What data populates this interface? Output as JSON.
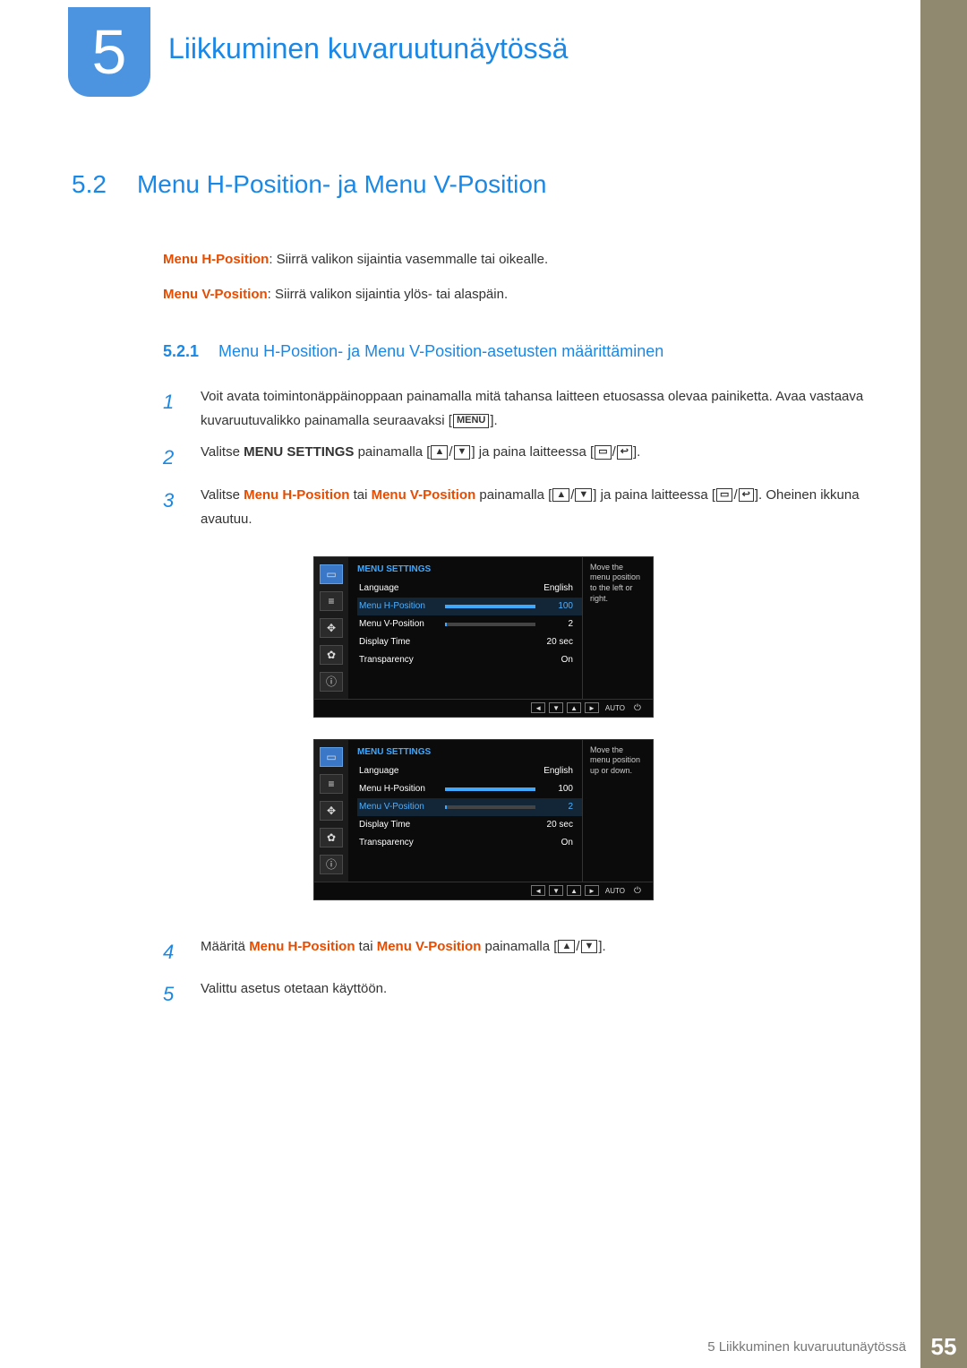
{
  "chapter": {
    "num": "5",
    "title": "Liikkuminen kuvaruutunäytössä"
  },
  "section": {
    "num": "5.2",
    "title": "Menu H-Position- ja Menu V-Position"
  },
  "intro": {
    "line1_term": "Menu H-Position",
    "line1_rest": ": Siirrä valikon sijaintia vasemmalle tai oikealle.",
    "line2_term": "Menu V-Position",
    "line2_rest": ": Siirrä valikon sijaintia ylös- tai alaspäin."
  },
  "subsection": {
    "num": "5.2.1",
    "title": "Menu H-Position- ja Menu V-Position-asetusten määrittäminen"
  },
  "steps": [
    {
      "n": "1",
      "parts": [
        "Voit avata toimintonäppäinoppaan painamalla mitä tahansa laitteen etuosassa olevaa painiketta. Avaa vastaava kuvaruutuvalikko painamalla seuraavaksi [",
        {
          "glyph": "MENU"
        },
        "]."
      ]
    },
    {
      "n": "2",
      "parts": [
        "Valitse ",
        {
          "bold": "MENU SETTINGS"
        },
        " painamalla [",
        {
          "glyph": "▲"
        },
        "/",
        {
          "glyph": "▼"
        },
        "] ja paina laitteessa [",
        {
          "glyph": "▭"
        },
        "/",
        {
          "glyph": "↩"
        },
        "]."
      ]
    },
    {
      "n": "3",
      "parts": [
        "Valitse ",
        {
          "orange_bold": "Menu H-Position"
        },
        " tai ",
        {
          "orange_bold": "Menu V-Position"
        },
        " painamalla [",
        {
          "glyph": "▲"
        },
        "/",
        {
          "glyph": "▼"
        },
        "] ja paina laitteessa [",
        {
          "glyph": "▭"
        },
        "/",
        {
          "glyph": "↩"
        },
        "]. Oheinen ikkuna avautuu."
      ]
    },
    {
      "n": "4",
      "parts": [
        "Määritä ",
        {
          "orange_bold": "Menu H-Position"
        },
        " tai ",
        {
          "orange_bold": "Menu V-Position"
        },
        " painamalla [",
        {
          "glyph": "▲"
        },
        "/",
        {
          "glyph": "▼"
        },
        "]."
      ]
    },
    {
      "n": "5",
      "parts": [
        "Valittu asetus otetaan käyttöön."
      ]
    }
  ],
  "osd1": {
    "title": "MENU SETTINGS",
    "side": "Move the menu position to the left or right.",
    "rows": [
      {
        "label": "Language",
        "value": "English",
        "slider": null,
        "sel": false
      },
      {
        "label": "Menu H-Position",
        "value": "100",
        "slider": 100,
        "sel": true
      },
      {
        "label": "Menu V-Position",
        "value": "2",
        "slider": 2,
        "sel": false
      },
      {
        "label": "Display Time",
        "value": "20 sec",
        "slider": null,
        "sel": false
      },
      {
        "label": "Transparency",
        "value": "On",
        "slider": null,
        "sel": false
      }
    ],
    "footer_auto": "AUTO"
  },
  "osd2": {
    "title": "MENU SETTINGS",
    "side": "Move the menu position up or down.",
    "rows": [
      {
        "label": "Language",
        "value": "English",
        "slider": null,
        "sel": false
      },
      {
        "label": "Menu H-Position",
        "value": "100",
        "slider": 100,
        "sel": false
      },
      {
        "label": "Menu V-Position",
        "value": "2",
        "slider": 2,
        "sel": true
      },
      {
        "label": "Display Time",
        "value": "20 sec",
        "slider": null,
        "sel": false
      },
      {
        "label": "Transparency",
        "value": "On",
        "slider": null,
        "sel": false
      }
    ],
    "footer_auto": "AUTO"
  },
  "footer": {
    "text": "5 Liikkuminen kuvaruutunäytössä",
    "page": "55"
  }
}
